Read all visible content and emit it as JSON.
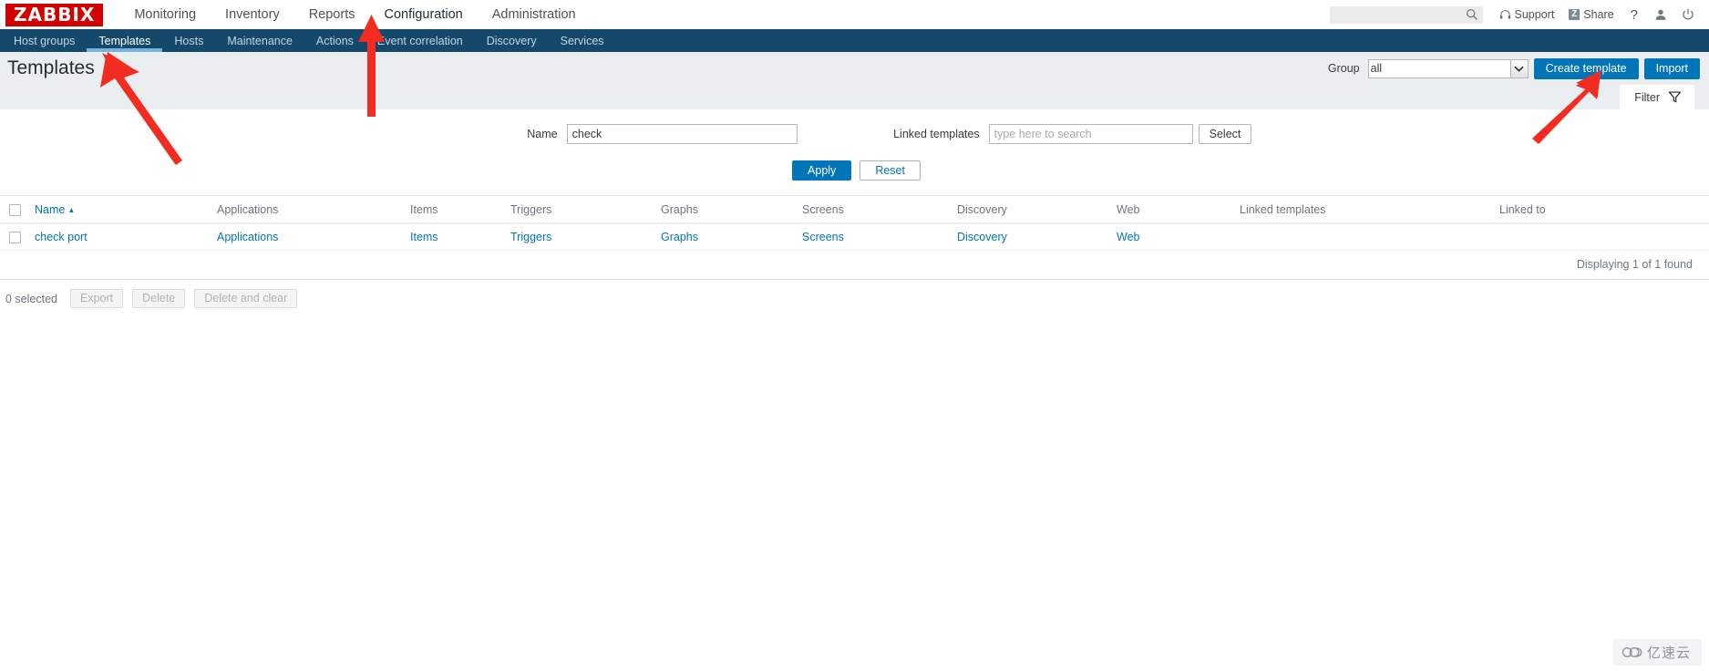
{
  "header": {
    "logo_text": "ZABBIX",
    "main_menu": [
      {
        "label": "Monitoring",
        "active": false
      },
      {
        "label": "Inventory",
        "active": false
      },
      {
        "label": "Reports",
        "active": false
      },
      {
        "label": "Configuration",
        "active": true
      },
      {
        "label": "Administration",
        "active": false
      }
    ],
    "search_value": "",
    "search_placeholder": "",
    "support_label": "Support",
    "share_label": "Share",
    "share_badge": "Z",
    "help_label": "?"
  },
  "subnav": {
    "items": [
      {
        "label": "Host groups",
        "active": false
      },
      {
        "label": "Templates",
        "active": true
      },
      {
        "label": "Hosts",
        "active": false
      },
      {
        "label": "Maintenance",
        "active": false
      },
      {
        "label": "Actions",
        "active": false
      },
      {
        "label": "Event correlation",
        "active": false
      },
      {
        "label": "Discovery",
        "active": false
      },
      {
        "label": "Services",
        "active": false
      }
    ]
  },
  "page": {
    "title": "Templates",
    "group_label": "Group",
    "group_value": "all",
    "group_options": [
      "all"
    ],
    "create_template_label": "Create template",
    "import_label": "Import"
  },
  "filter": {
    "tab_label": "Filter",
    "name_label": "Name",
    "name_value": "check",
    "linked_templates_label": "Linked templates",
    "linked_templates_value": "",
    "linked_templates_placeholder": "type here to search",
    "select_label": "Select",
    "apply_label": "Apply",
    "reset_label": "Reset"
  },
  "table": {
    "columns": [
      "Name",
      "Applications",
      "Items",
      "Triggers",
      "Graphs",
      "Screens",
      "Discovery",
      "Web",
      "Linked templates",
      "Linked to"
    ],
    "sort_column": "Name",
    "sort_direction": "asc",
    "sort_indicator": "▲",
    "rows": [
      {
        "name": "check port",
        "applications": "Applications",
        "items": "Items",
        "triggers": "Triggers",
        "graphs": "Graphs",
        "screens": "Screens",
        "discovery": "Discovery",
        "web": "Web",
        "linked_templates": "",
        "linked_to": ""
      }
    ],
    "displaying": "Displaying 1 of 1 found"
  },
  "actions": {
    "selected_label": "0 selected",
    "export_label": "Export",
    "delete_label": "Delete",
    "delete_clear_label": "Delete and clear"
  },
  "watermark": {
    "text": "亿速云"
  },
  "colors": {
    "brand_red": "#d40000",
    "nav_blue": "#14496b",
    "accent_blue": "#0275b8",
    "tab_underline": "#76b3e2",
    "arrow_red": "#f22c21",
    "page_bg": "#ebeef0"
  }
}
